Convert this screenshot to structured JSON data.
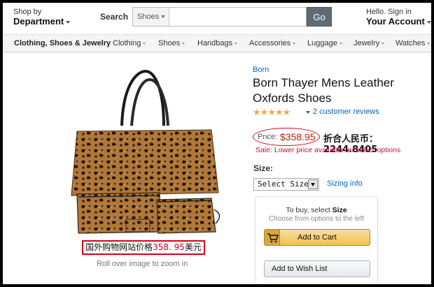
{
  "header": {
    "shop_by_small": "Shop by",
    "shop_by_big": "Department",
    "search_label": "Search",
    "search_category": "Shoes",
    "search_placeholder": "",
    "go_button": "Go",
    "account_small": "Hello. Sign in",
    "account_big": "Your Account"
  },
  "nav": {
    "items": [
      "Clothing, Shoes & Jewelry",
      "Clothing",
      "Shoes",
      "Handbags",
      "Accessories",
      "Luggage",
      "Jewelry",
      "Watches"
    ]
  },
  "product": {
    "image_caption_prefix": "国外购物网站价格",
    "image_caption_price": "358. 95",
    "image_caption_suffix": "美元",
    "zoom_hint": "Roll over image to zoom in",
    "brand": "Born",
    "title": "Born Thayer Mens Leather Oxfords Shoes",
    "rating_stars": "★★★★★",
    "reviews": "2 customer reviews",
    "price_label": "Pnce:",
    "price": "$358.95",
    "rmb_price": "折合人民币：2244.8405",
    "sale_text": "Sale:  Lower price available on select options",
    "size_label": "Size:",
    "size_select": "Select Size",
    "sizing_info": "Sizing info"
  },
  "buybox": {
    "hint_prefix": "To buy, select ",
    "hint_bold": "Size",
    "sub_hint": "Choose from options to the left",
    "add_to_cart": "Add to Cart",
    "add_to_wishlist": "Add to Wish List"
  },
  "colors": {
    "accent_link": "#0066c0",
    "price_red": "#b12704",
    "annotation_red": "#d0021b",
    "cart_button": "#f0c14b"
  }
}
